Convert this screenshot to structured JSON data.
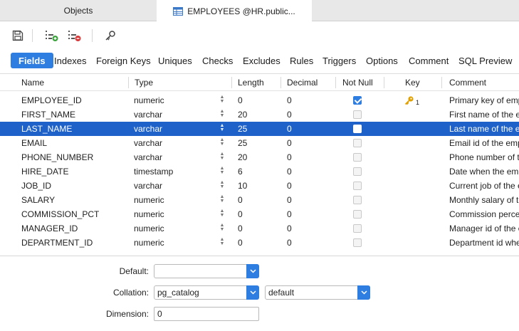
{
  "window_tabs": [
    {
      "label": "Objects"
    },
    {
      "label": "EMPLOYEES @HR.public..."
    }
  ],
  "toolbar": {
    "buttons": [
      "save-icon",
      "add-field-icon",
      "delete-field-icon",
      "key-icon"
    ]
  },
  "subtabs": [
    "Fields",
    "Indexes",
    "Foreign Keys",
    "Uniques",
    "Checks",
    "Excludes",
    "Rules",
    "Triggers",
    "Options",
    "Comment",
    "SQL Preview"
  ],
  "active_subtab": "Fields",
  "grid": {
    "columns": [
      "Name",
      "Type",
      "Length",
      "Decimal",
      "Not Null",
      "Key",
      "Comment"
    ],
    "rows": [
      {
        "name": "EMPLOYEE_ID",
        "type": "numeric",
        "length": "0",
        "decimal": "0",
        "not_null": true,
        "key": "1",
        "comment": "Primary key of emp"
      },
      {
        "name": "FIRST_NAME",
        "type": "varchar",
        "length": "20",
        "decimal": "0",
        "not_null": false,
        "key": "",
        "comment": "First name of the em"
      },
      {
        "name": "LAST_NAME",
        "type": "varchar",
        "length": "25",
        "decimal": "0",
        "not_null": false,
        "key": "",
        "comment": "Last name of the em"
      },
      {
        "name": "EMAIL",
        "type": "varchar",
        "length": "25",
        "decimal": "0",
        "not_null": false,
        "key": "",
        "comment": "Email id of the emp"
      },
      {
        "name": "PHONE_NUMBER",
        "type": "varchar",
        "length": "20",
        "decimal": "0",
        "not_null": false,
        "key": "",
        "comment": "Phone number of th"
      },
      {
        "name": "HIRE_DATE",
        "type": "timestamp",
        "length": "6",
        "decimal": "0",
        "not_null": false,
        "key": "",
        "comment": "Date when the emp"
      },
      {
        "name": "JOB_ID",
        "type": "varchar",
        "length": "10",
        "decimal": "0",
        "not_null": false,
        "key": "",
        "comment": "Current job of the e"
      },
      {
        "name": "SALARY",
        "type": "numeric",
        "length": "0",
        "decimal": "0",
        "not_null": false,
        "key": "",
        "comment": "Monthly salary of th"
      },
      {
        "name": "COMMISSION_PCT",
        "type": "numeric",
        "length": "0",
        "decimal": "0",
        "not_null": false,
        "key": "",
        "comment": "Commission percen"
      },
      {
        "name": "MANAGER_ID",
        "type": "numeric",
        "length": "0",
        "decimal": "0",
        "not_null": false,
        "key": "",
        "comment": "Manager id of the e"
      },
      {
        "name": "DEPARTMENT_ID",
        "type": "numeric",
        "length": "0",
        "decimal": "0",
        "not_null": false,
        "key": "",
        "comment": "Department id whe"
      }
    ],
    "selected_row": 2
  },
  "form": {
    "default_label": "Default:",
    "default_value": "",
    "collation_label": "Collation:",
    "collation_schema": "pg_catalog",
    "collation_value": "default",
    "dimension_label": "Dimension:",
    "dimension_value": "0"
  },
  "colors": {
    "accent": "#2e7de1",
    "selection": "#1e62c9",
    "key_gold": "#e0a100"
  }
}
